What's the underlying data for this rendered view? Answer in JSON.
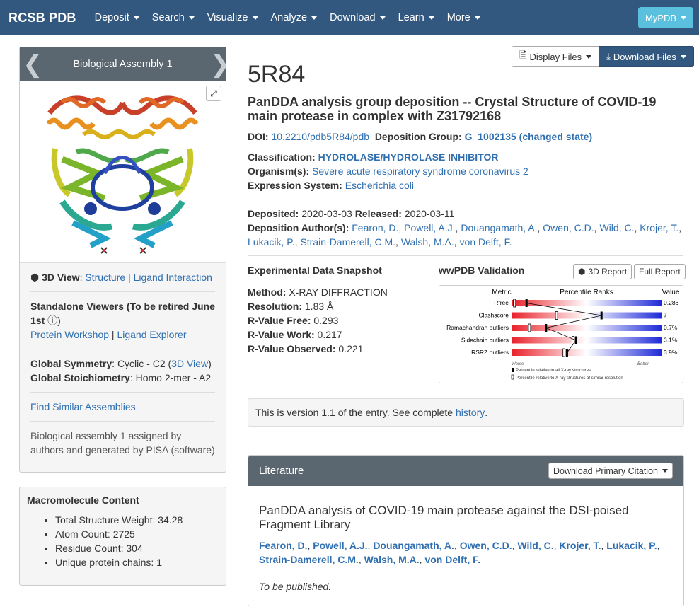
{
  "navbar": {
    "brand": "RCSB PDB",
    "items": [
      "Deposit",
      "Search",
      "Visualize",
      "Analyze",
      "Download",
      "Learn",
      "More"
    ],
    "mypdb": "MyPDB"
  },
  "left": {
    "assembly_title": "Biological Assembly 1",
    "view3d_label": "3D View",
    "view3d_links": [
      "Structure",
      "Ligand Interaction"
    ],
    "standalone_label": "Standalone Viewers  (To be retired June 1st",
    "standalone_links": [
      "Protein Workshop",
      "Ligand Explorer"
    ],
    "symmetry_label": "Global Symmetry",
    "symmetry_value": "Cyclic - C2",
    "symmetry_link": "3D View",
    "stoich_label": "Global Stoichiometry",
    "stoich_value": "Homo 2-mer - A2",
    "find_similar": "Find Similar Assemblies",
    "assembly_note": "Biological assembly 1 assigned by authors and generated by PISA (software)"
  },
  "macro": {
    "title": "Macromolecule Content",
    "items": [
      "Total Structure Weight: 34.28",
      "Atom Count: 2725",
      "Residue Count: 304",
      "Unique protein chains: 1"
    ]
  },
  "header": {
    "display_files": "Display Files",
    "download_files": "Download Files",
    "pdb_id": "5R84",
    "title": "PanDDA analysis group deposition -- Crystal Structure of COVID-19 main protease in complex with Z31792168"
  },
  "doi": {
    "label": "DOI:",
    "value": "10.2210/pdb5R84/pdb",
    "group_label": "Deposition Group:",
    "group_value": "G_1002135",
    "group_state": "(changed state)"
  },
  "info": {
    "classification_label": "Classification:",
    "classification_value": "HYDROLASE/HYDROLASE INHIBITOR",
    "organism_label": "Organism(s):",
    "organism_value": "Severe acute respiratory syndrome coronavirus 2",
    "expression_label": "Expression System:",
    "expression_value": "Escherichia coli"
  },
  "dates": {
    "deposited_label": "Deposited:",
    "deposited_value": "2020-03-03",
    "released_label": "Released:",
    "released_value": "2020-03-11",
    "authors_label": "Deposition Author(s):",
    "authors": [
      "Fearon, D.",
      "Powell, A.J.",
      "Douangamath, A.",
      "Owen, C.D.",
      "Wild, C.",
      "Krojer, T.",
      "Lukacik, P.",
      "Strain-Damerell, C.M.",
      "Walsh, M.A.",
      "von Delft, F."
    ]
  },
  "snapshot": {
    "title": "Experimental Data Snapshot",
    "rows": [
      {
        "label": "Method:",
        "value": "X-RAY DIFFRACTION"
      },
      {
        "label": "Resolution:",
        "value": "1.83 Å"
      },
      {
        "label": "R-Value Free:",
        "value": "0.293"
      },
      {
        "label": "R-Value Work:",
        "value": "0.217"
      },
      {
        "label": "R-Value Observed:",
        "value": "0.221"
      }
    ]
  },
  "validation": {
    "title": "wwPDB Validation",
    "btn_3d": "3D Report",
    "btn_full": "Full Report",
    "col_metric": "Metric",
    "col_percentile": "Percentile Ranks",
    "col_value": "Value",
    "metrics": [
      {
        "name": "Rfree",
        "value": "0.286",
        "abs_pct": 0.1,
        "rel_pct": 0.02
      },
      {
        "name": "Clashscore",
        "value": "7",
        "abs_pct": 0.6,
        "rel_pct": 0.3
      },
      {
        "name": "Ramachandran outliers",
        "value": "0.7%",
        "abs_pct": 0.23,
        "rel_pct": 0.12
      },
      {
        "name": "Sidechain outliers",
        "value": "3.1%",
        "abs_pct": 0.43,
        "rel_pct": 0.41
      },
      {
        "name": "RSRZ outliers",
        "value": "3.9%",
        "abs_pct": 0.37,
        "rel_pct": 0.35
      }
    ],
    "worse": "Worse",
    "better": "Better",
    "legend_abs": "Percentile relative to all X-ray structures",
    "legend_rel": "Percentile relative to X-ray structures of similar resolution"
  },
  "version": {
    "text": "This is version 1.1 of the entry. See complete",
    "link": "history",
    "end": "."
  },
  "literature": {
    "header": "Literature",
    "download_btn": "Download Primary Citation",
    "title": "PanDDA analysis of COVID-19 main protease against the DSI-poised Fragment Library",
    "authors": [
      "Fearon, D.",
      "Powell, A.J.",
      "Douangamath, A.",
      "Owen, C.D.",
      "Wild, C.",
      "Krojer, T.",
      "Lukacik, P.",
      "Strain-Damerell, C.M.",
      "Walsh, M.A.",
      "von Delft, F."
    ],
    "status": "To be published."
  }
}
